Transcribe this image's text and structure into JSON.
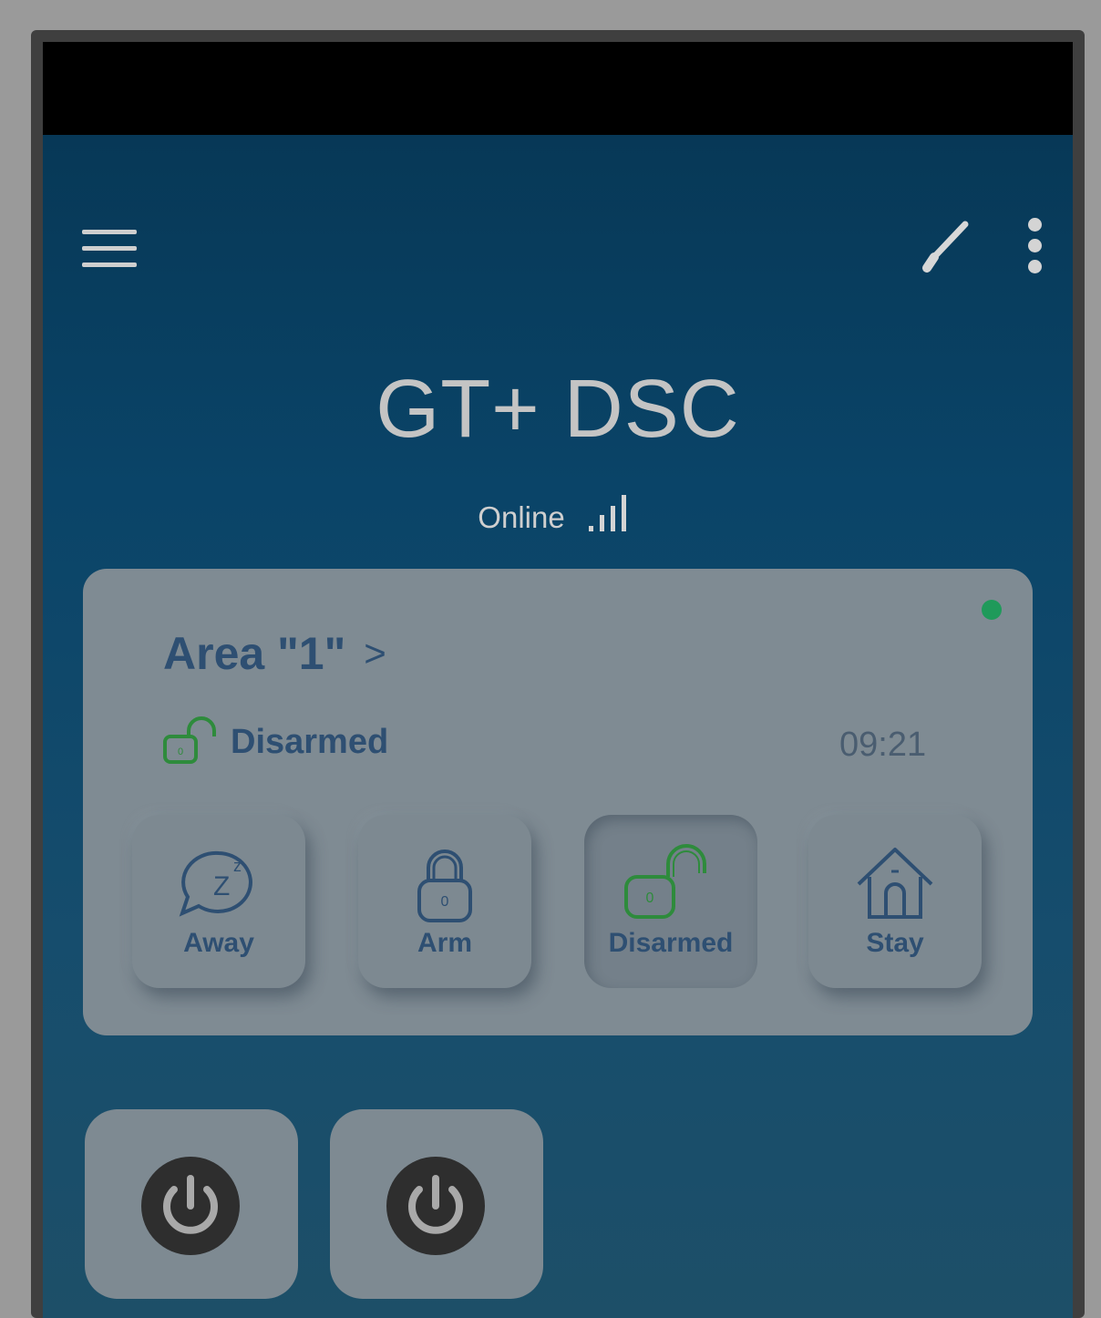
{
  "app": {
    "title": "GT+ DSC",
    "connection_status": "Online"
  },
  "appbar": {
    "menu_icon": "hamburger-menu-icon",
    "edit_icon": "edit-pencil-icon",
    "more_icon": "more-vert-icon"
  },
  "area": {
    "title": "Area \"1\"",
    "chevron": ">",
    "status_label": "Disarmed",
    "time": "09:21",
    "indicator_color": "#1f9a5a",
    "modes": [
      {
        "label": "Away",
        "icon": "sleep-bubble-icon",
        "active": false
      },
      {
        "label": "Arm",
        "icon": "lock-closed-icon",
        "active": false
      },
      {
        "label": "Disarmed",
        "icon": "lock-open-icon",
        "active": true
      },
      {
        "label": "Stay",
        "icon": "house-icon",
        "active": false
      }
    ]
  },
  "outputs": [
    {
      "icon": "power-icon"
    },
    {
      "icon": "power-icon"
    }
  ],
  "colors": {
    "accent_green": "#2e8b3c",
    "label_blue": "#2e4f72"
  }
}
